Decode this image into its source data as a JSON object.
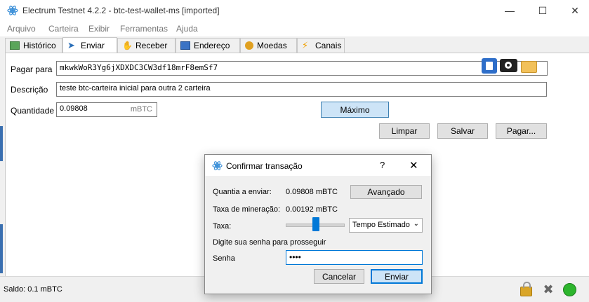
{
  "window": {
    "title": "Electrum Testnet 4.2.2  -  btc-test-wallet-ms  [imported]"
  },
  "menu": [
    "Arquivo",
    "Carteira",
    "Exibir",
    "Ferramentas",
    "Ajuda"
  ],
  "tabs": [
    "Histórico",
    "Enviar",
    "Receber",
    "Endereço",
    "Moedas",
    "Canais"
  ],
  "send": {
    "pay_to_label": "Pagar para",
    "pay_to_value": "mkwkWoR3Yg6jXDXDC3CW3df18mrF8emSf7",
    "description_label": "Descrição",
    "description_value": "teste btc-carteira inicial para outra 2 carteira",
    "amount_label": "Quantidade",
    "amount_value": "0.09808",
    "amount_unit": "mBTC",
    "max_button": "Máximo",
    "clear_button": "Limpar",
    "save_button": "Salvar",
    "pay_button": "Pagar..."
  },
  "status": {
    "balance": "Saldo: 0.1 mBTC"
  },
  "dialog": {
    "title": "Confirmar transação",
    "help": "?",
    "amount_label": "Quantia a enviar:",
    "amount_value": "0.09808 mBTC",
    "advanced_button": "Avançado",
    "fee_label": "Taxa de mineração:",
    "fee_value": "0.00192 mBTC",
    "rate_label": "Taxa:",
    "fee_mode": "Tempo Estimado",
    "prompt": "Digite sua senha para prosseguir",
    "password_label": "Senha",
    "password_value": "••••",
    "cancel_button": "Cancelar",
    "send_button": "Enviar"
  },
  "colors": {
    "accent": "#0078d7",
    "status_ok": "#2db52d",
    "focus_button": "#cde4f7"
  }
}
